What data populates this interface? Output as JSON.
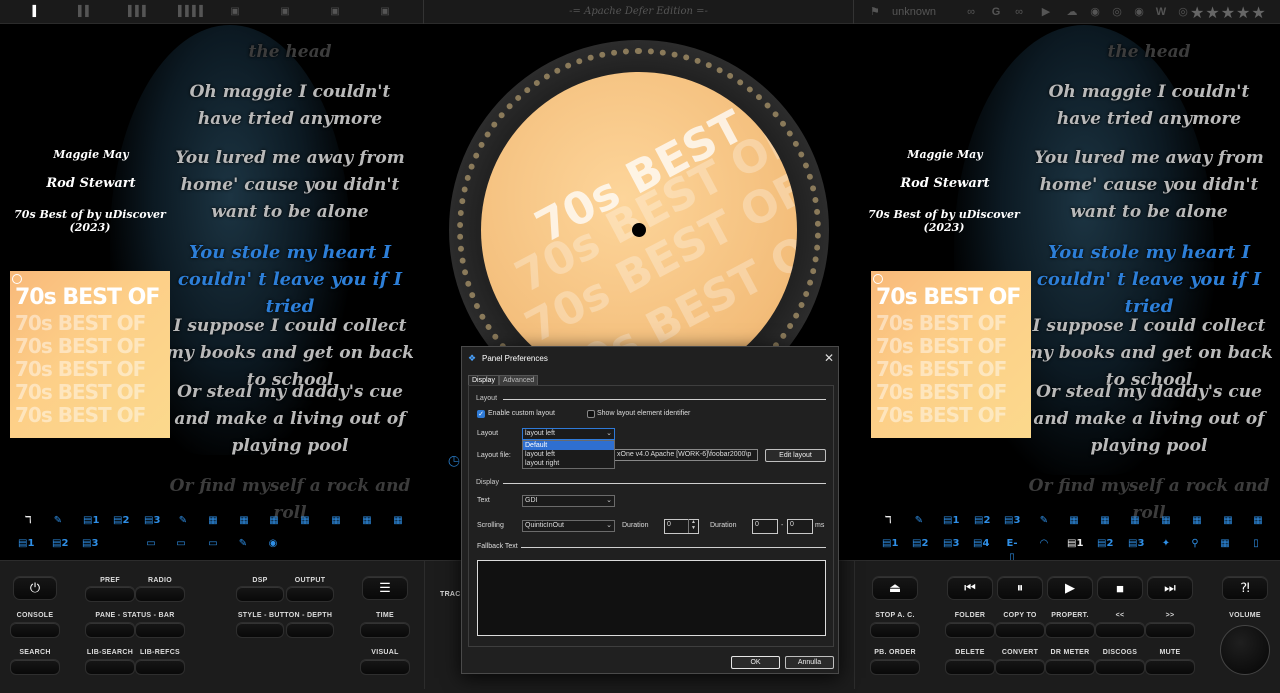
{
  "topbar": {
    "edition": "-= Apache Defer Edition =-",
    "status_text": "unknown",
    "rating": "★★★★★"
  },
  "left": {
    "meta_title": "Maggie May",
    "meta_artist": "Rod Stewart",
    "meta_album": "70s Best of by uDiscover (2023)",
    "lyrics": [
      {
        "text": "the head",
        "style": "dim"
      },
      {
        "text": "Oh maggie I couldn't have tried anymore",
        "style": "normal"
      },
      {
        "text": "You lured me away from home' cause you didn't want to be alone",
        "style": "normal"
      },
      {
        "text": "You stole my heart I couldn' t leave you if I tried",
        "style": "active"
      },
      {
        "text": "I suppose I could collect my books and get on back to school",
        "style": "normal"
      },
      {
        "text": "Or steal my daddy's cue and make a living out of playing pool",
        "style": "normal"
      },
      {
        "text": "Or find myself a rock and roll",
        "style": "dim"
      }
    ]
  },
  "cover": {
    "title": "70s BEST OF",
    "ghost": "70s BEST OF"
  },
  "vinyl": {
    "text": "70s BEST OF"
  },
  "track_label": "TRACK",
  "bottom": {
    "left_buttons": {
      "pref": "PREF",
      "radio": "RADIO",
      "dsp": "DSP",
      "output": "OUTPUT",
      "console": "CONSOLE",
      "pane": "PANE - STATUS - BAR",
      "style": "STYLE - BUTTON - DEPTH",
      "time": "TIME",
      "search": "SEARCH",
      "lib_search": "LIB-SEARCH",
      "lib_refcs": "LIB-REFCS",
      "visual": "VISUAL"
    },
    "right_buttons": {
      "stop_ac": "STOP A. C.",
      "folder": "FOLDER",
      "copy_to": "COPY TO",
      "propert": "PROPERT.",
      "prev": "<<",
      "next": ">>",
      "volume": "VOLUME",
      "pb_order": "PB. ORDER",
      "delete": "DELETE",
      "convert": "CONVERT",
      "dr_meter": "DR METER",
      "discogs": "DISCOGS",
      "mute": "MUTE"
    },
    "transport": {
      "eject": "⏏",
      "prev": "⏮",
      "pause": "⏸",
      "play": "▶",
      "stop": "■",
      "next": "⏭",
      "help": "⁈"
    }
  },
  "icons": {
    "left_row1": [
      "ℸ",
      "✎",
      "▤1",
      "▤2",
      "▤3",
      "✎",
      "▦",
      "▦",
      "▦",
      "▦",
      "▦",
      "▦",
      "▦"
    ],
    "left_row2": [
      "▤1",
      "▤2",
      "▤3",
      "▭",
      "▭",
      "▭",
      "✎",
      "◉"
    ],
    "right_row1": [
      "ℸ",
      "✎",
      "▤1",
      "▤2",
      "▤3",
      "✎",
      "▦",
      "▦",
      "▦",
      "▦",
      "▦",
      "▦",
      "▦"
    ],
    "right_row2": [
      "▤1",
      "▤2",
      "▤3",
      "▤4",
      "E-▯",
      "◠",
      "▤1",
      "▤2",
      "▤3",
      "✦",
      "⚲",
      "▦",
      "▯"
    ]
  },
  "dialog": {
    "title": "Panel Preferences",
    "tab_display": "Display",
    "tab_advanced": "Advanced",
    "section_layout": "Layout",
    "enable_custom": "Enable custom layout",
    "show_identifier": "Show layout element identifier",
    "layout_label": "Layout",
    "layout_value": "layout left",
    "layout_options": [
      "Default",
      "layout left",
      "layout right"
    ],
    "layout_file_label": "Layout file:",
    "layout_file_value": "xOne v4.0 Apache [WORK-6]\\foobar2000\\p",
    "edit_layout": "Edit layout",
    "section_display": "Display",
    "text_label": "Text",
    "text_value": "GDI",
    "scrolling_label": "Scrolling",
    "scrolling_value": "QuinticInOut",
    "duration_label": "Duration",
    "duration1": "0",
    "duration2_label": "Duration",
    "duration2a": "0",
    "duration2b": "0",
    "dash": "-",
    "ms": "ms",
    "fallback_label": "Fallback Text",
    "ok": "OK",
    "cancel": "Annulla"
  }
}
